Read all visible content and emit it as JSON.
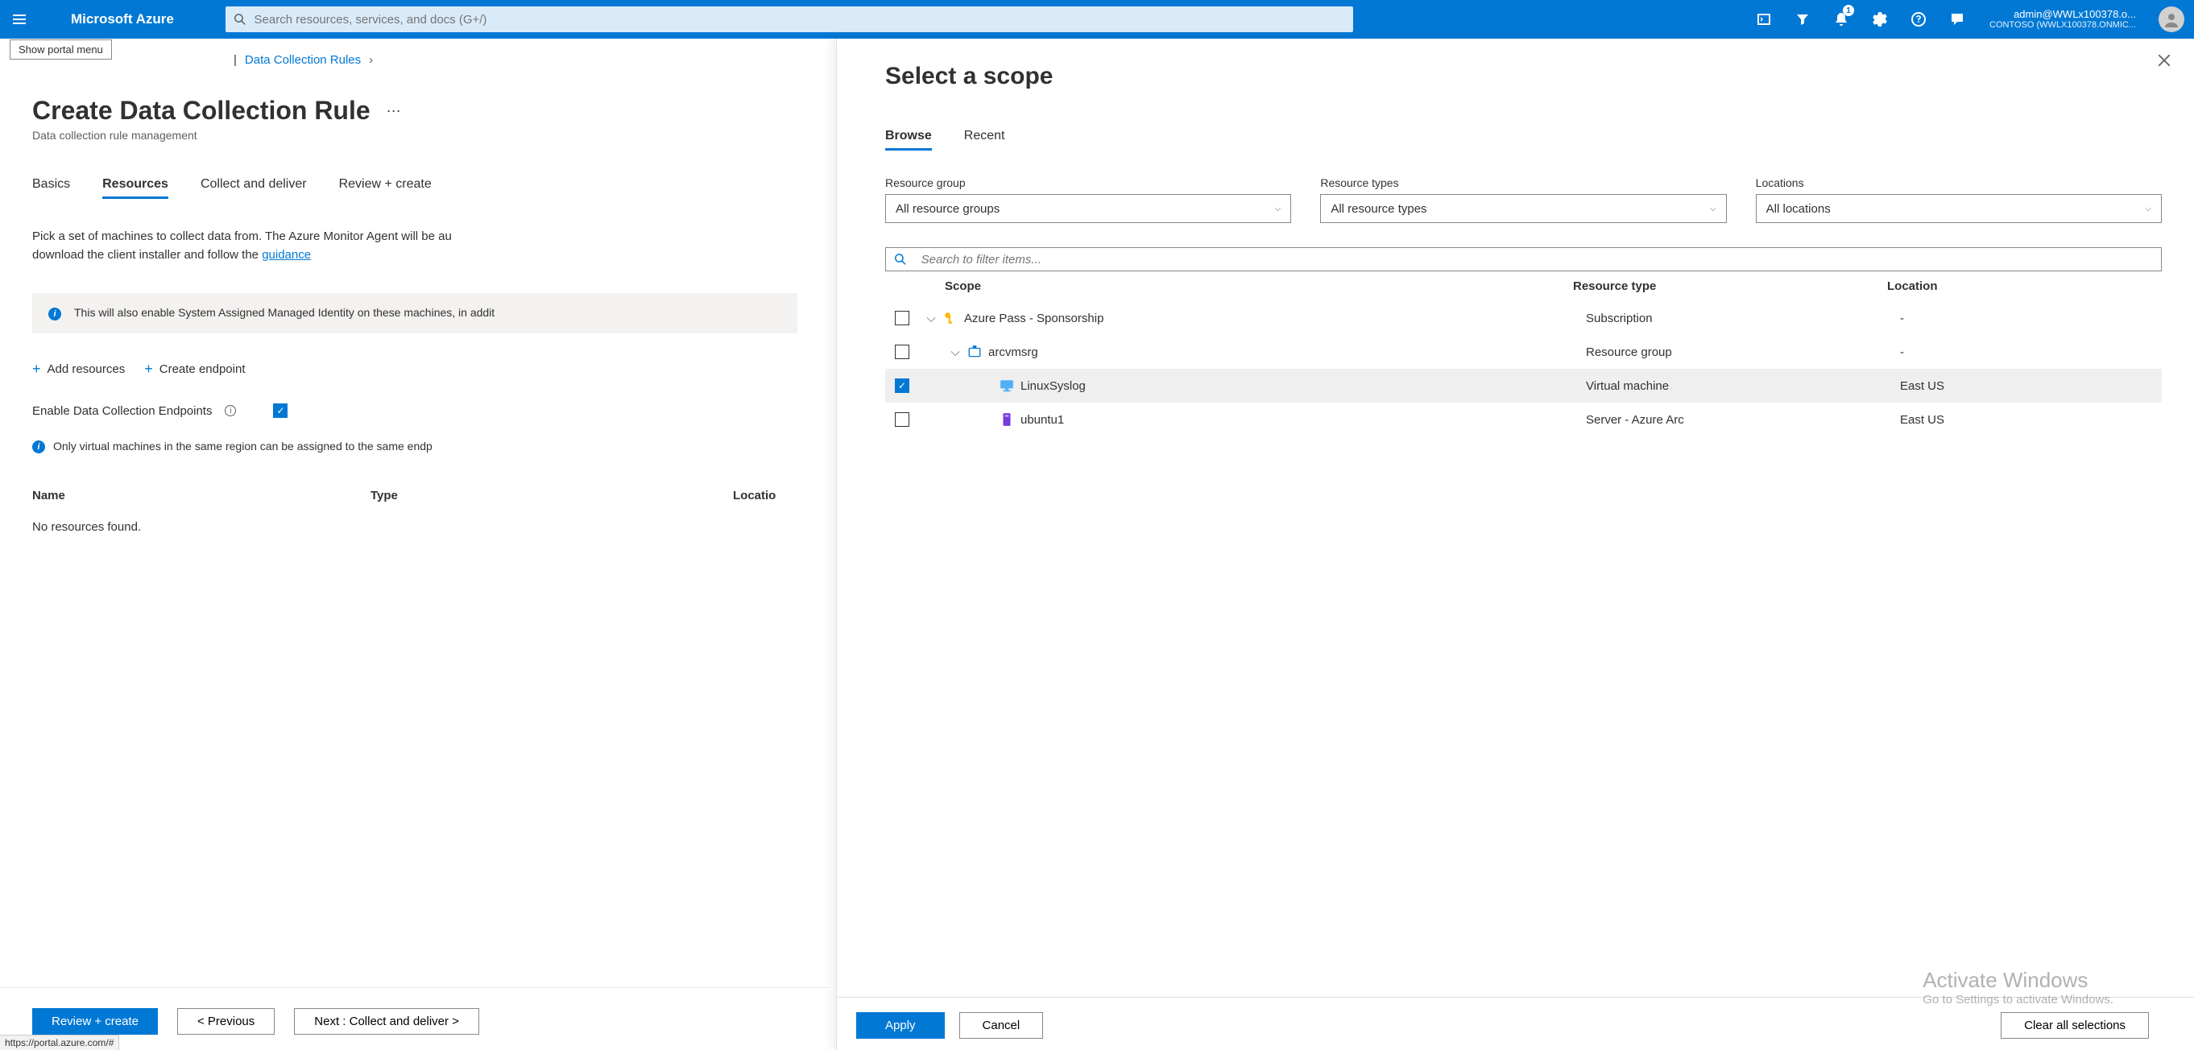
{
  "topbar": {
    "brand": "Microsoft Azure",
    "search_placeholder": "Search resources, services, and docs (G+/)",
    "notifications_count": "1",
    "account_email": "admin@WWLx100378.o...",
    "account_tenant": "CONTOSO (WWLX100378.ONMIC..."
  },
  "tooltip": {
    "text": "Show portal menu"
  },
  "breadcrumb": {
    "parent": "Data Collection Rules",
    "hidden_prefix": "..."
  },
  "page": {
    "title": "Create Data Collection Rule",
    "subtitle": "Data collection rule management"
  },
  "tabs": [
    {
      "id": "basics",
      "label": "Basics"
    },
    {
      "id": "resources",
      "label": "Resources",
      "active": true
    },
    {
      "id": "collect",
      "label": "Collect and deliver"
    },
    {
      "id": "review",
      "label": "Review + create"
    }
  ],
  "description": {
    "prefix": "Pick a set of machines to collect data from. The Azure Monitor Agent will be au",
    "line2_prefix": "download the client installer and follow the ",
    "link_text": "guidance"
  },
  "info_banner": {
    "text": "This will also enable System Assigned Managed Identity on these machines, in addit"
  },
  "commands": {
    "add_resources": "Add resources",
    "create_endpoint": "Create endpoint"
  },
  "endpoints": {
    "label": "Enable Data Collection Endpoints",
    "checked": true
  },
  "region_note": "Only virtual machines in the same region can be assigned to the same endp",
  "resources_table": {
    "headers": {
      "name": "Name",
      "type": "Type",
      "location": "Locatio"
    },
    "empty": "No resources found."
  },
  "footer": {
    "review": "Review + create",
    "previous": "< Previous",
    "next": "Next : Collect and deliver >",
    "status_url": "https://portal.azure.com/#"
  },
  "panel": {
    "title": "Select a scope",
    "tabs": [
      {
        "id": "browse",
        "label": "Browse",
        "active": true
      },
      {
        "id": "recent",
        "label": "Recent"
      }
    ],
    "filters": {
      "resource_group": {
        "label": "Resource group",
        "value": "All resource groups"
      },
      "resource_types": {
        "label": "Resource types",
        "value": "All resource types"
      },
      "locations": {
        "label": "Locations",
        "value": "All locations"
      }
    },
    "search_placeholder": "Search to filter items...",
    "headers": {
      "scope": "Scope",
      "type": "Resource type",
      "location": "Location"
    },
    "rows": [
      {
        "level": 0,
        "checked": false,
        "expand": "open",
        "icon": "key",
        "name": "Azure Pass - Sponsorship",
        "type": "Subscription",
        "location": "-"
      },
      {
        "level": 1,
        "checked": false,
        "expand": "open",
        "icon": "rg",
        "name": "arcvmsrg",
        "type": "Resource group",
        "location": "-"
      },
      {
        "level": 2,
        "checked": true,
        "expand": "",
        "icon": "vm",
        "name": "LinuxSyslog",
        "type": "Virtual machine",
        "location": "East US"
      },
      {
        "level": 2,
        "checked": false,
        "expand": "",
        "icon": "arc",
        "name": "ubuntu1",
        "type": "Server - Azure Arc",
        "location": "East US"
      }
    ],
    "footer": {
      "apply": "Apply",
      "cancel": "Cancel",
      "clear": "Clear all selections"
    }
  },
  "watermark": {
    "title": "Activate Windows",
    "sub": "Go to Settings to activate Windows."
  }
}
